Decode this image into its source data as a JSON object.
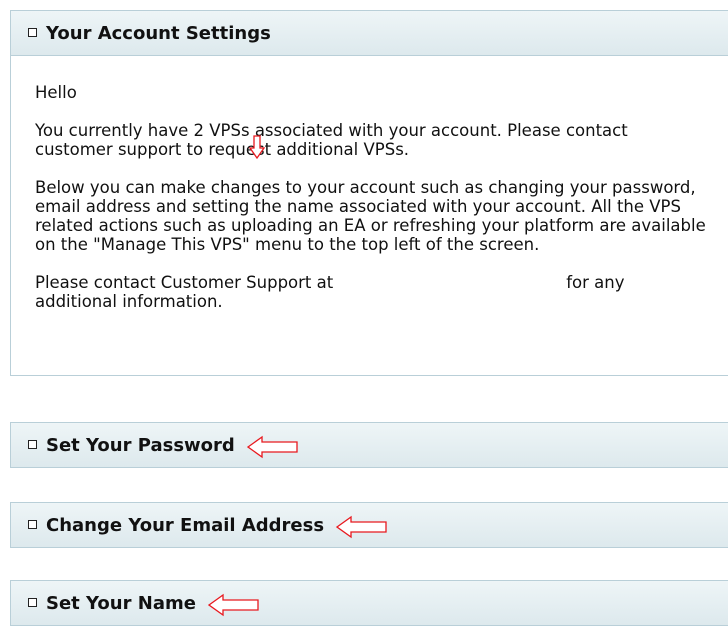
{
  "account_settings": {
    "header": "Your Account Settings",
    "greeting": "Hello",
    "vps_info": "You currently have 2 VPSs associated with your account. Please contact customer support to request additional VPSs.",
    "changes_info": "Below you can make changes to your account such as changing your password, email address and setting the name associated with your account. All the VPS related actions such as uploading an EA or refreshing your platform are available on the \"Manage This VPS\" menu to the top left of the screen.",
    "contact_prefix": "Please contact Customer Support at",
    "contact_suffix": "for any additional information."
  },
  "sections": {
    "password": "Set Your Password",
    "email": "Change Your Email Address",
    "name": "Set Your Name"
  },
  "colors": {
    "arrow": "#e8191f",
    "border": "#b9cfd8"
  }
}
